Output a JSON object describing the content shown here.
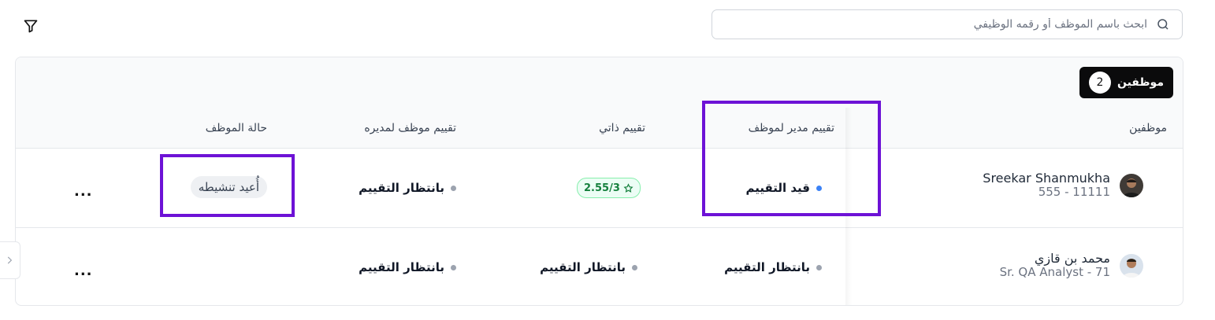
{
  "search": {
    "placeholder": "ابحث باسم الموظف أو رقمه الوظيفي",
    "icon": "search-icon"
  },
  "toolbar": {
    "filter_icon": "filter-icon"
  },
  "summary": {
    "label": "موظفين",
    "count": "2"
  },
  "columns": {
    "employees": "موظفين",
    "manager_rating": "تقييم مدير لموظف",
    "self_rating": "تقييم ذاتي",
    "employee_rating_manager": "تقييم موظف لمديره",
    "employee_status": "حالة الموظف"
  },
  "rows": [
    {
      "name": "Sreekar Shanmukha",
      "subtitle": "11111 - 555",
      "manager_rating": {
        "label": "قيد التقييم",
        "dot_color": "#3b82f6"
      },
      "self_rating": {
        "score": "2.55/3"
      },
      "employee_rating_manager": {
        "label": "بانتظار التقييم",
        "dot_color": "#9ca3af"
      },
      "employee_status": {
        "label": "أُعيد تنشيطه"
      },
      "more": "..."
    },
    {
      "name": "محمد بن قازي",
      "subtitle": "Sr. QA Analyst - 71",
      "manager_rating": {
        "label": "بانتظار التقييم",
        "dot_color": "#9ca3af"
      },
      "self_rating": {
        "label": "بانتظار التقييم",
        "dot_color": "#9ca3af"
      },
      "employee_rating_manager": {
        "label": "بانتظار التقييم",
        "dot_color": "#9ca3af"
      },
      "employee_status": {
        "label": ""
      },
      "more": "..."
    }
  ],
  "colors": {
    "highlight": "#6d12d6",
    "score_green": "#15803d",
    "badge_bg": "#0b0b0c"
  }
}
